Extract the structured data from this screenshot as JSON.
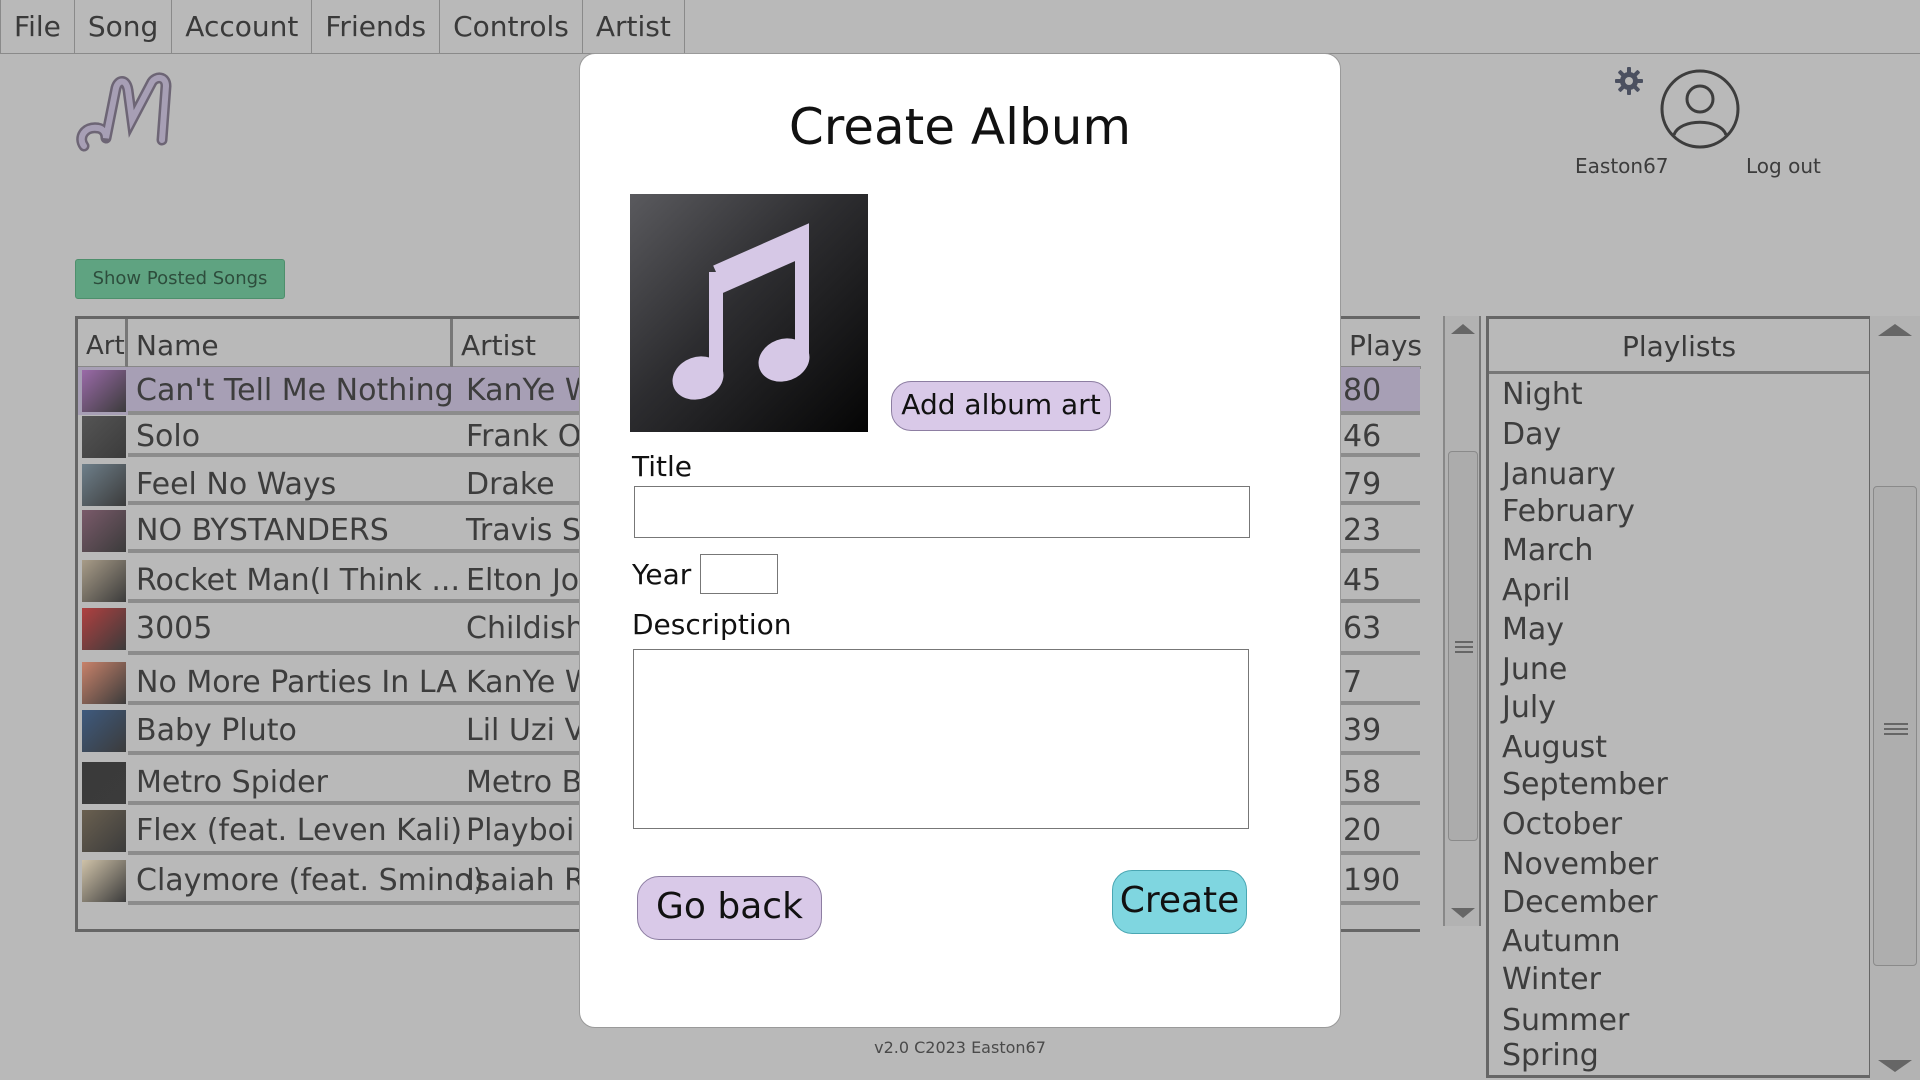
{
  "menu": [
    "File",
    "Song",
    "Account",
    "Friends",
    "Controls",
    "Artist"
  ],
  "user": {
    "name": "Easton67",
    "logout": "Log out",
    "settings_icon": "gear-icon",
    "avatar_icon": "user-avatar-icon"
  },
  "buttons": {
    "show_posted": "Show Posted Songs"
  },
  "table": {
    "headers": {
      "art": "Art",
      "name": "Name",
      "artist": "Artist",
      "plays": "Plays"
    },
    "rows": [
      {
        "name": "Can't Tell Me Nothing",
        "artist": "KanYe W",
        "plays": "80",
        "selected": true,
        "thumb_color": "#9a6aa8"
      },
      {
        "name": "Solo",
        "artist": "Frank Oc",
        "plays": "46",
        "thumb_color": "#555555"
      },
      {
        "name": "Feel No Ways",
        "artist": "Drake",
        "plays": "79",
        "thumb_color": "#6e7f8a"
      },
      {
        "name": "NO BYSTANDERS",
        "artist": "Travis Sc",
        "plays": "23",
        "thumb_color": "#7a5a6a"
      },
      {
        "name": "Rocket Man(I Think ...",
        "artist": "Elton Joh",
        "plays": "45",
        "thumb_color": "#a89c88"
      },
      {
        "name": "3005",
        "artist": "Childish",
        "plays": "63",
        "thumb_color": "#b04040"
      },
      {
        "name": "No More Parties In LA",
        "artist": "KanYe W",
        "plays": "7",
        "thumb_color": "#c8826a"
      },
      {
        "name": "Baby Pluto",
        "artist": "Lil Uzi Ve",
        "plays": "39",
        "thumb_color": "#3e5a7e"
      },
      {
        "name": "Metro Spider",
        "artist": "Metro Bo",
        "plays": "58",
        "thumb_color": "#3a3a3a"
      },
      {
        "name": "Flex (feat. Leven Kali)",
        "artist": "Playboi C",
        "plays": "20",
        "thumb_color": "#6a6050"
      },
      {
        "name": "Claymore (feat. Smino)",
        "artist": "Isaiah Ra",
        "plays": "190",
        "thumb_color": "#cfc2a8"
      }
    ]
  },
  "playlists": {
    "header": "Playlists",
    "items": [
      "Night",
      "Day",
      "January",
      "February",
      "March",
      "April",
      "May",
      "June",
      "July",
      "August",
      "September",
      "October",
      "November",
      "December",
      "Autumn",
      "Winter",
      "Summer",
      "Spring"
    ]
  },
  "footer": "v2.0 C2023 Easton67",
  "modal": {
    "title": "Create Album",
    "add_art": "Add album art",
    "title_label": "Title",
    "title_value": "",
    "year_label": "Year",
    "year_value": "",
    "description_label": "Description",
    "description_value": "",
    "back": "Go back",
    "create": "Create",
    "art_icon": "music-note-icon"
  },
  "colors": {
    "accent_purple": "#d9c9e8",
    "accent_teal": "#7fd6e0",
    "posted_green": "#5fa381",
    "selected_row": "#a79fb5"
  }
}
